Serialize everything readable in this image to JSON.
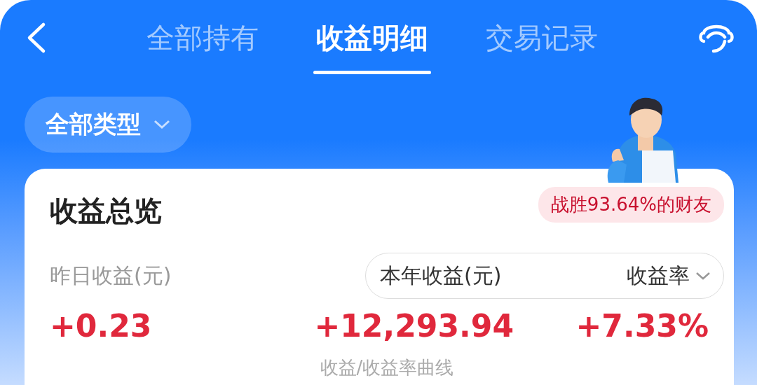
{
  "tabs": [
    {
      "label": "全部持有",
      "selected": false
    },
    {
      "label": "收益明细",
      "selected": true
    },
    {
      "label": "交易记录",
      "selected": false
    }
  ],
  "filter": {
    "label": "全部类型"
  },
  "overview": {
    "title": "收益总览",
    "badge": "战胜93.64%的财友",
    "yesterday": {
      "label": "昨日收益(元)",
      "value": "+0.23"
    },
    "year": {
      "label": "本年收益(元)",
      "value": "+12,293.94"
    },
    "rate": {
      "label": "收益率",
      "value": "+7.33%"
    },
    "curve_link": "收益/收益率曲线"
  }
}
